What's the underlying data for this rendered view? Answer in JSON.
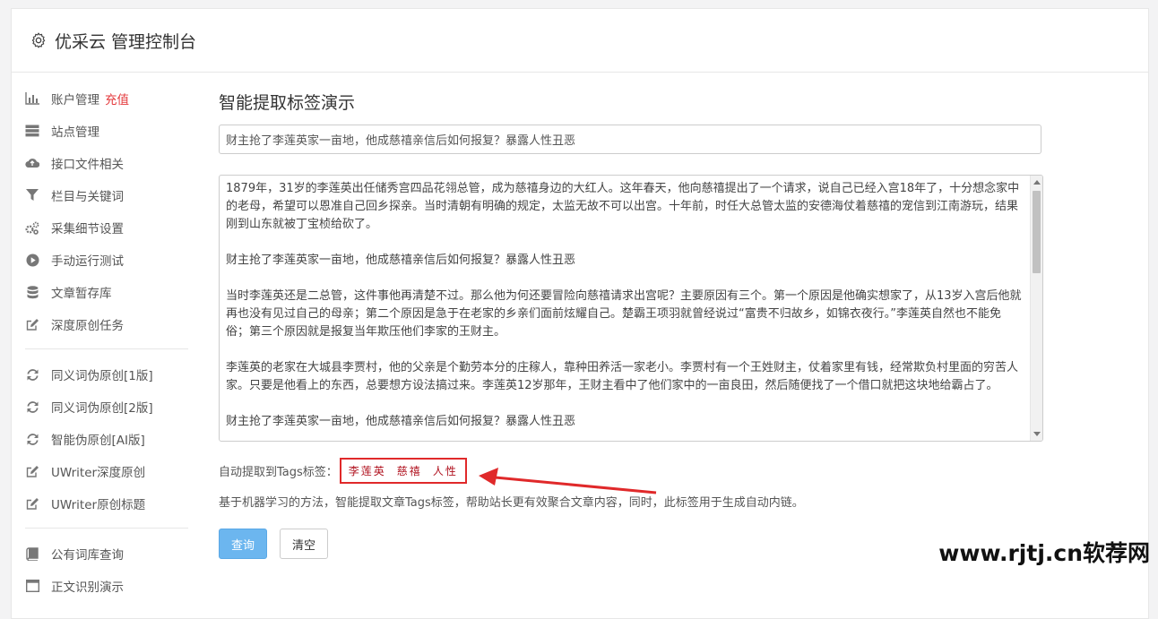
{
  "header": {
    "title": "优采云 管理控制台"
  },
  "sidebar": {
    "group1": [
      {
        "label": "账户管理",
        "badge": "充值",
        "icon": "bar-chart-icon"
      },
      {
        "label": "站点管理",
        "icon": "server-icon"
      },
      {
        "label": "接口文件相关",
        "icon": "cloud-upload-icon"
      },
      {
        "label": "栏目与关键词",
        "icon": "filter-icon"
      },
      {
        "label": "采集细节设置",
        "icon": "gears-icon"
      },
      {
        "label": "手动运行测试",
        "icon": "play-circle-icon"
      },
      {
        "label": "文章暂存库",
        "icon": "database-icon"
      },
      {
        "label": "深度原创任务",
        "icon": "edit-icon"
      }
    ],
    "group2": [
      {
        "label": "同义词伪原创[1版]",
        "icon": "refresh-icon"
      },
      {
        "label": "同义词伪原创[2版]",
        "icon": "refresh-icon"
      },
      {
        "label": "智能伪原创[AI版]",
        "icon": "refresh-icon"
      },
      {
        "label": "UWriter深度原创",
        "icon": "edit-icon"
      },
      {
        "label": "UWriter原创标题",
        "icon": "edit-icon"
      }
    ],
    "group3": [
      {
        "label": "公有词库查询",
        "icon": "book-icon"
      },
      {
        "label": "正文识别演示",
        "icon": "window-icon"
      }
    ]
  },
  "main": {
    "heading": "智能提取标签演示",
    "title_value": "财主抢了李莲英家一亩地，他成慈禧亲信后如何报复？暴露人性丑恶",
    "content_paragraphs": [
      "1879年，31岁的李莲英出任储秀宫四品花翎总管，成为慈禧身边的大红人。这年春天，他向慈禧提出了一个请求，说自己已经入宫18年了，十分想念家中的老母，希望可以恩准自己回乡探亲。当时清朝有明确的规定，太监无故不可以出宫。十年前，时任大总管太监的安德海仗着慈禧的宠信到江南游玩，结果刚到山东就被丁宝桢给砍了。",
      "财主抢了李莲英家一亩地，他成慈禧亲信后如何报复？暴露人性丑恶",
      "当时李莲英还是二总管，这件事他再清楚不过。那么他为何还要冒险向慈禧请求出宫呢？主要原因有三个。第一个原因是他确实想家了，从13岁入宫后他就再也没有见过自己的母亲；第二个原因是急于在老家的乡亲们面前炫耀自己。楚霸王项羽就曾经说过“富贵不归故乡，如锦衣夜行。”李莲英自然也不能免俗；第三个原因就是报复当年欺压他们李家的王财主。",
      "李莲英的老家在大城县李贾村，他的父亲是个勤劳本分的庄稼人，靠种田养活一家老小。李贾村有一个王姓财主，仗着家里有钱，经常欺负村里面的穷苦人家。只要是他看上的东西，总要想方设法搞过来。李莲英12岁那年，王财主看中了他们家中的一亩良田，然后随便找了一个借口就把这块地给霸占了。",
      "财主抢了李莲英家一亩地，他成慈禧亲信后如何报复？暴露人性丑恶"
    ],
    "tags_label": "自动提取到Tags标签：",
    "tags": [
      "李莲英",
      "慈禧",
      "人性"
    ],
    "description": "基于机器学习的方法，智能提取文章Tags标签，帮助站长更有效聚合文章内容，同时，此标签用于生成自动内链。",
    "query_label": "查询",
    "clear_label": "清空"
  },
  "watermark": "www.rjtj.cn软荐网",
  "colors": {
    "accent": "#6cb6ef",
    "highlight": "#e0292a",
    "badge": "#e4393c"
  }
}
